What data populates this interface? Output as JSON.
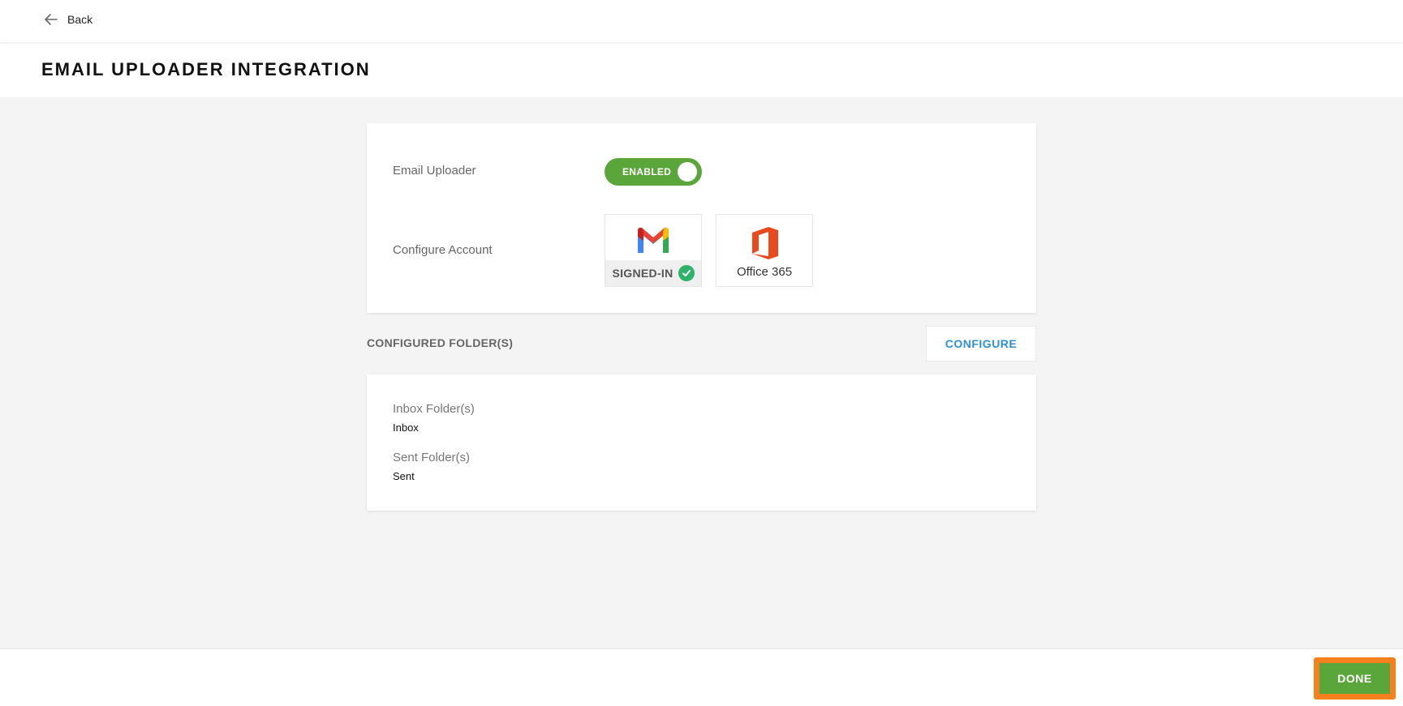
{
  "nav": {
    "back_label": "Back"
  },
  "page": {
    "title": "EMAIL UPLOADER INTEGRATION"
  },
  "account_card": {
    "uploader_label": "Email Uploader",
    "toggle_state": "ENABLED",
    "configure_label": "Configure Account",
    "providers": [
      {
        "name": "gmail",
        "status": "SIGNED-IN",
        "icon": "gmail-icon"
      },
      {
        "name": "Office 365",
        "icon": "office-365-icon"
      }
    ]
  },
  "folders": {
    "heading": "CONFIGURED FOLDER(S)",
    "configure_button": "CONFIGURE",
    "inbox_label": "Inbox Folder(s)",
    "inbox_value": "Inbox",
    "sent_label": "Sent Folder(s)",
    "sent_value": "Sent"
  },
  "footer": {
    "done_label": "DONE"
  },
  "colors": {
    "toggle_on": "#5aa63a",
    "signed_in_check": "#2fb36b",
    "configure_text": "#2f8fd0",
    "done_highlight": "#f5801e",
    "done_button": "#5aa63a"
  }
}
